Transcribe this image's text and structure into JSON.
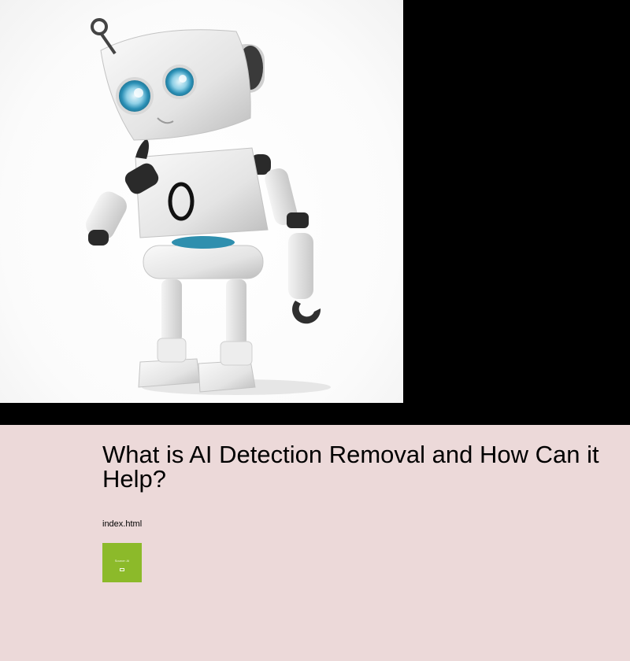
{
  "hero": {
    "image_alt": "Robot illustration",
    "chest_letter": "0"
  },
  "article": {
    "title": "What is AI Detection Removal and How Can it Help?",
    "link_text": "index.html"
  },
  "thumbnail": {
    "label": "Source: AI",
    "icon": "play-icon",
    "color": "#8cba2a"
  },
  "colors": {
    "background": "#000000",
    "content_background": "#ecd9d9"
  }
}
